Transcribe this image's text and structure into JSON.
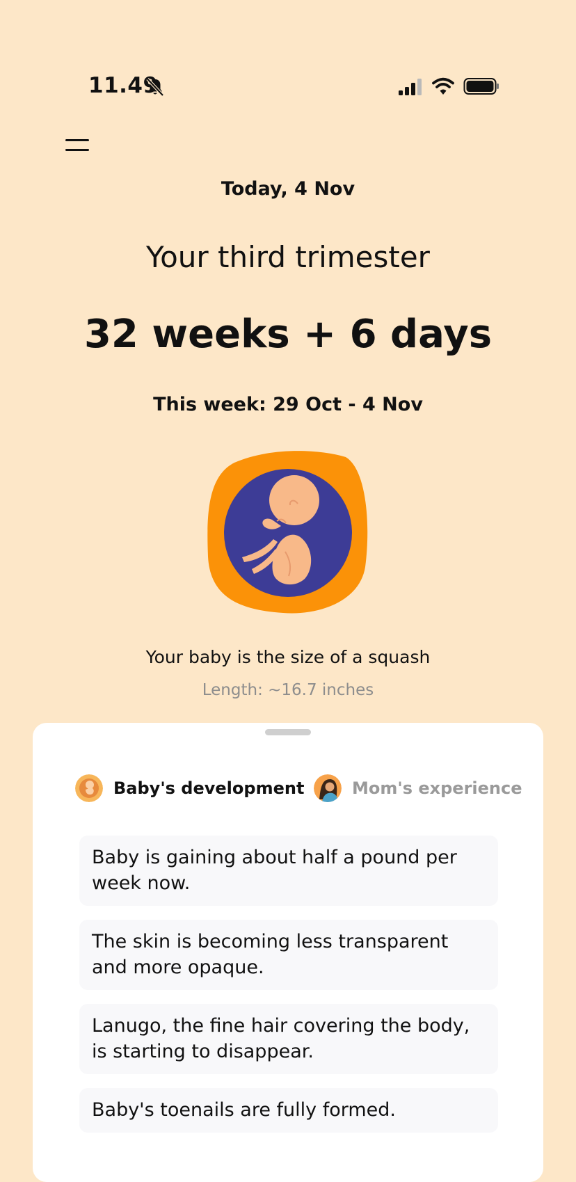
{
  "status_bar": {
    "time": "11.49",
    "icons": [
      "bell-slash-icon",
      "signal-icon",
      "wifi-icon",
      "battery-icon"
    ]
  },
  "header": {
    "menu_icon": "hamburger-menu-icon",
    "today": "Today, 4 Nov"
  },
  "pregnancy": {
    "trimester": "Your third trimester",
    "weeks": "32 weeks + 6 days",
    "week_range": "This week: 29 Oct - 4 Nov",
    "size_comparison": "Your baby is the size of a squash",
    "length": "Length: ~16.7 inches"
  },
  "sheet": {
    "tabs": [
      {
        "label": "Baby's development",
        "active": true,
        "icon": "baby-avatar-icon"
      },
      {
        "label": "Mom's experience",
        "active": false,
        "icon": "mom-avatar-icon"
      }
    ],
    "facts": [
      "Baby is gaining about half a pound per week now.",
      "The skin is becoming less transparent and more opaque.",
      "Lanugo, the fine hair covering the body, is starting to disappear.",
      "Baby's toenails are fully formed."
    ]
  },
  "colors": {
    "background": "#fde7c8",
    "illustration_orange": "#fb9208",
    "illustration_indigo": "#3d3c96",
    "fetus_skin": "#f8b989",
    "muted_text": "#8d8d8d"
  }
}
